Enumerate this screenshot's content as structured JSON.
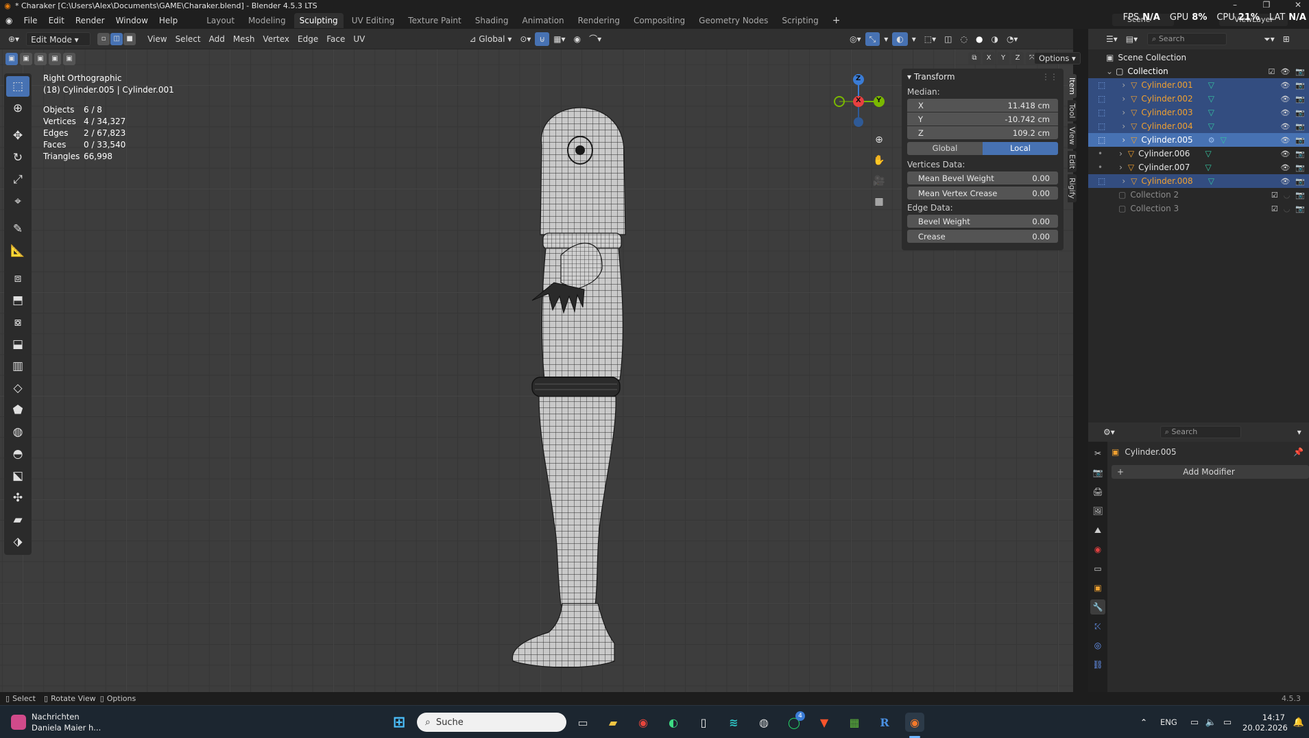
{
  "window": {
    "title": "* Charaker [C:\\Users\\Alex\\Documents\\GAME\\Charaker.blend] - Blender 4.5.3 LTS"
  },
  "menu": [
    "File",
    "Edit",
    "Render",
    "Window",
    "Help"
  ],
  "workspaces": [
    "Layout",
    "Modeling",
    "Sculpting",
    "UV Editing",
    "Texture Paint",
    "Shading",
    "Animation",
    "Rendering",
    "Compositing",
    "Geometry Nodes",
    "Scripting"
  ],
  "active_workspace": "Sculpting",
  "perf_overlay": {
    "fps_label": "FPS",
    "fps": "N/A",
    "gpu_label": "GPU",
    "gpu": "8%",
    "cpu_label": "CPU",
    "cpu": "21%",
    "lat_label": "LAT",
    "lat": "N/A"
  },
  "scene_field": "Scene",
  "viewlayer_field": "ViewLayer",
  "viewport_header": {
    "mode": "Edit Mode",
    "menus": [
      "View",
      "Select",
      "Add",
      "Mesh",
      "Vertex",
      "Edge",
      "Face",
      "UV"
    ],
    "orientation": "Global",
    "options": "Options",
    "axes": [
      "X",
      "Y",
      "Z"
    ]
  },
  "viewport_info": {
    "view": "Right Orthographic",
    "object": "(18) Cylinder.005 | Cylinder.001"
  },
  "stats": [
    {
      "k": "Objects",
      "v": "6 / 8"
    },
    {
      "k": "Vertices",
      "v": "4 / 34,327"
    },
    {
      "k": "Edges",
      "v": "2 / 67,823"
    },
    {
      "k": "Faces",
      "v": "0 / 33,540"
    },
    {
      "k": "Triangles",
      "v": "66,998"
    }
  ],
  "gizmo": {
    "x": "X",
    "y": "Y",
    "z": "Z"
  },
  "npanel": {
    "title": "Transform",
    "median": "Median:",
    "x_label": "X",
    "x": "11.418 cm",
    "y_label": "Y",
    "y": "-10.742 cm",
    "z_label": "Z",
    "z": "109.2 cm",
    "global": "Global",
    "local": "Local",
    "vertices_data": "Vertices Data:",
    "mean_bevel": "Mean Bevel Weight",
    "mean_bevel_v": "0.00",
    "mean_crease": "Mean Vertex Crease",
    "mean_crease_v": "0.00",
    "edge_data": "Edge Data:",
    "bevel": "Bevel Weight",
    "bevel_v": "0.00",
    "crease": "Crease",
    "crease_v": "0.00",
    "tabs": [
      "Item",
      "Tool",
      "View",
      "Edit",
      "Rigify"
    ]
  },
  "outliner": {
    "search": "Search",
    "scene_collection": "Scene Collection",
    "collection": "Collection",
    "objects": [
      {
        "name": "Cylinder.001",
        "state": "sel"
      },
      {
        "name": "Cylinder.002",
        "state": "sel"
      },
      {
        "name": "Cylinder.003",
        "state": "sel"
      },
      {
        "name": "Cylinder.004",
        "state": "sel"
      },
      {
        "name": "Cylinder.005",
        "state": "active"
      },
      {
        "name": "Cylinder.006",
        "state": "none"
      },
      {
        "name": "Cylinder.007",
        "state": "none"
      },
      {
        "name": "Cylinder.008",
        "state": "sel"
      }
    ],
    "collection2": "Collection 2",
    "collection3": "Collection 3"
  },
  "properties": {
    "search": "Search",
    "object": "Cylinder.005",
    "add_modifier": "Add Modifier"
  },
  "statusbar": {
    "select": "Select",
    "rotate": "Rotate View",
    "options": "Options",
    "version": "4.5.3"
  },
  "taskbar": {
    "notif_title": "Nachrichten",
    "notif_sub": "Daniela Maier h...",
    "search": "Suche",
    "lang": "ENG",
    "time": "14:17",
    "date": "20.02.2026",
    "whatsapp_badge": "4"
  }
}
